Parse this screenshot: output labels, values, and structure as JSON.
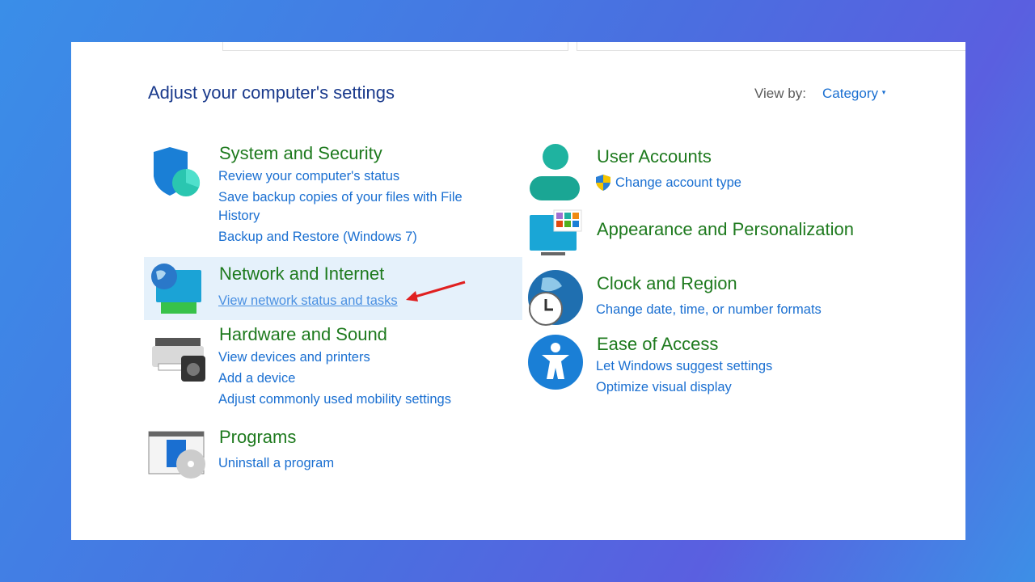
{
  "page": {
    "title": "Adjust your computer's settings"
  },
  "view_by": {
    "label": "View by:",
    "value": "Category"
  },
  "left": [
    {
      "heading": "System and Security",
      "icon": "shield-icon",
      "links": [
        "Review your computer's status",
        "Save backup copies of your files with File",
        "History",
        "Backup and Restore (Windows 7)"
      ]
    },
    {
      "heading": "Network and Internet",
      "icon": "network-icon",
      "links": [
        "View network status and tasks"
      ]
    },
    {
      "heading": "Hardware and Sound",
      "icon": "printer-icon",
      "links": [
        "View devices and printers",
        "Add a device",
        "Adjust commonly used mobility settings"
      ]
    },
    {
      "heading": "Programs",
      "icon": "programs-icon",
      "links": [
        "Uninstall a program"
      ]
    }
  ],
  "right": [
    {
      "heading": "User Accounts",
      "icon": "user-icon",
      "links": [
        "Change account type"
      ]
    },
    {
      "heading": "Appearance and Personalization",
      "icon": "monitor-icon",
      "links": []
    },
    {
      "heading": "Clock and Region",
      "icon": "clock-globe-icon",
      "links": [
        "Change date, time, or number formats"
      ]
    },
    {
      "heading": "Ease of Access",
      "icon": "accessibility-icon",
      "links": [
        "Let Windows suggest settings",
        "Optimize visual display"
      ]
    }
  ],
  "colors": {
    "heading": "#1e7a1e",
    "link": "#1a6fd1",
    "highlight": "#e5f1fb",
    "annotation_arrow": "#e02020"
  }
}
